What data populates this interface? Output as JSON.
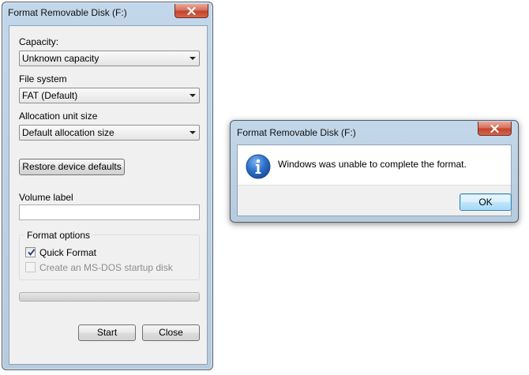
{
  "format_dialog": {
    "title": "Format Removable Disk (F:)",
    "capacity": {
      "label": "Capacity:",
      "value": "Unknown capacity"
    },
    "file_system": {
      "label": "File system",
      "value": "FAT (Default)"
    },
    "allocation": {
      "label": "Allocation unit size",
      "value": "Default allocation size"
    },
    "restore_label": "Restore device defaults",
    "volume_label": {
      "label": "Volume label",
      "value": ""
    },
    "format_options": {
      "title": "Format options",
      "quick_format": {
        "label": "Quick Format",
        "checked": true
      },
      "msdos_disk": {
        "label": "Create an MS-DOS startup disk",
        "checked": false,
        "enabled": false
      }
    },
    "progress": 0,
    "start_label": "Start",
    "close_label": "Close"
  },
  "error_dialog": {
    "title": "Format Removable Disk (F:)",
    "icon": "info-icon",
    "message": "Windows was unable to complete the format.",
    "ok_label": "OK"
  },
  "colors": {
    "window_frame": "#c2d7ea",
    "close_button": "#c2432a",
    "client_background": "#f0f0f0",
    "info_icon": "#1e63b8",
    "ok_button": "#bee6fd"
  }
}
